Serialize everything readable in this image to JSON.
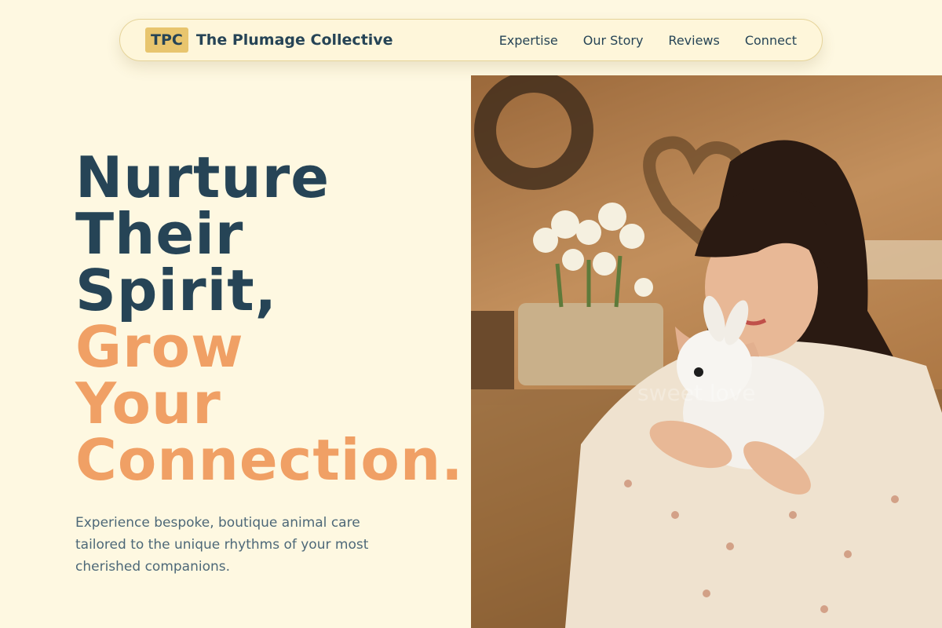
{
  "nav": {
    "badge": "TPC",
    "brand_name": "The Plumage Collective",
    "links": [
      "Expertise",
      "Our Story",
      "Reviews",
      "Connect"
    ]
  },
  "hero": {
    "headline_dark": [
      "Nurture",
      "Their",
      "Spirit,"
    ],
    "headline_accent": [
      "Grow",
      "Your",
      "Connection."
    ],
    "subtitle": "Experience bespoke, boutique animal care tailored to the unique rhythms of your most cherished companions.",
    "image_watermark": "sweet love"
  },
  "colors": {
    "background": "#fef8e1",
    "dark": "#264456",
    "accent": "#f0a065",
    "badge": "#e8c56e"
  }
}
